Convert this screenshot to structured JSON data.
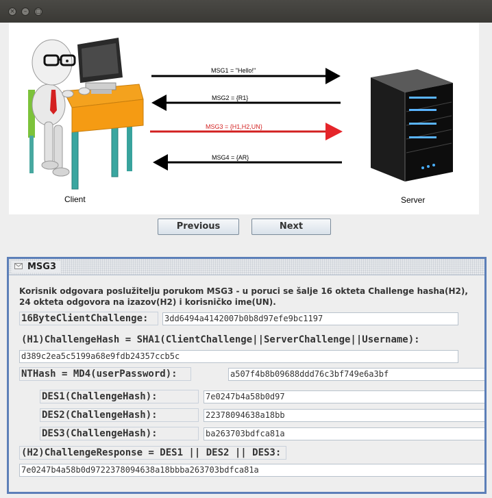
{
  "window": {
    "buttons": {
      "close": "×",
      "minimize": "–",
      "maximize": "□"
    }
  },
  "diagram": {
    "client_label": "Client",
    "server_label": "Server",
    "messages": [
      {
        "text": "MSG1 = \"Hello!\"",
        "direction": "right",
        "color": "#000000"
      },
      {
        "text": "MSG2 = {R1}",
        "direction": "left",
        "color": "#000000"
      },
      {
        "text": "MSG3 = {H1,H2,UN}",
        "direction": "right",
        "color": "#d21f1f"
      },
      {
        "text": "MSG4 = {AR}",
        "direction": "left",
        "color": "#000000"
      }
    ]
  },
  "nav": {
    "previous": "Previous",
    "next": "Next"
  },
  "frame": {
    "title": "MSG3",
    "description_line1": "Korisnik odgovara poslužitelju porukom MSG3 - u poruci se šalje 16 okteta Challenge hasha(H2),",
    "description_line2": "24 okteta odgovora na izazov(H2) i korisničko ime(UN).",
    "client_challenge_label": "16ByteClientChallenge:",
    "client_challenge_value": "3dd6494a4142007b0b8d97efe9bc1197",
    "challenge_hash_label": "(H1)ChallengeHash = SHA1(ClientChallenge||ServerChallenge||Username):",
    "challenge_hash_value": "d389c2ea5c5199a68e9fdb24357ccb5c",
    "nthash_label": "NTHash = MD4(userPassword):",
    "nthash_value": "a507f4b8b09688ddd76c3bf749e6a3bf",
    "des1_label": "DES1(ChallengeHash):",
    "des1_value": "7e0247b4a58b0d97",
    "des2_label": "DES2(ChallengeHash):",
    "des2_value": "22378094638a18bb",
    "des3_label": "DES3(ChallengeHash):",
    "des3_value": "ba263703bdfca81a",
    "response_label": "(H2)ChallengeResponse = DES1 || DES2 || DES3:",
    "response_value": "7e0247b4a58b0d9722378094638a18bbba263703bdfca81a"
  }
}
